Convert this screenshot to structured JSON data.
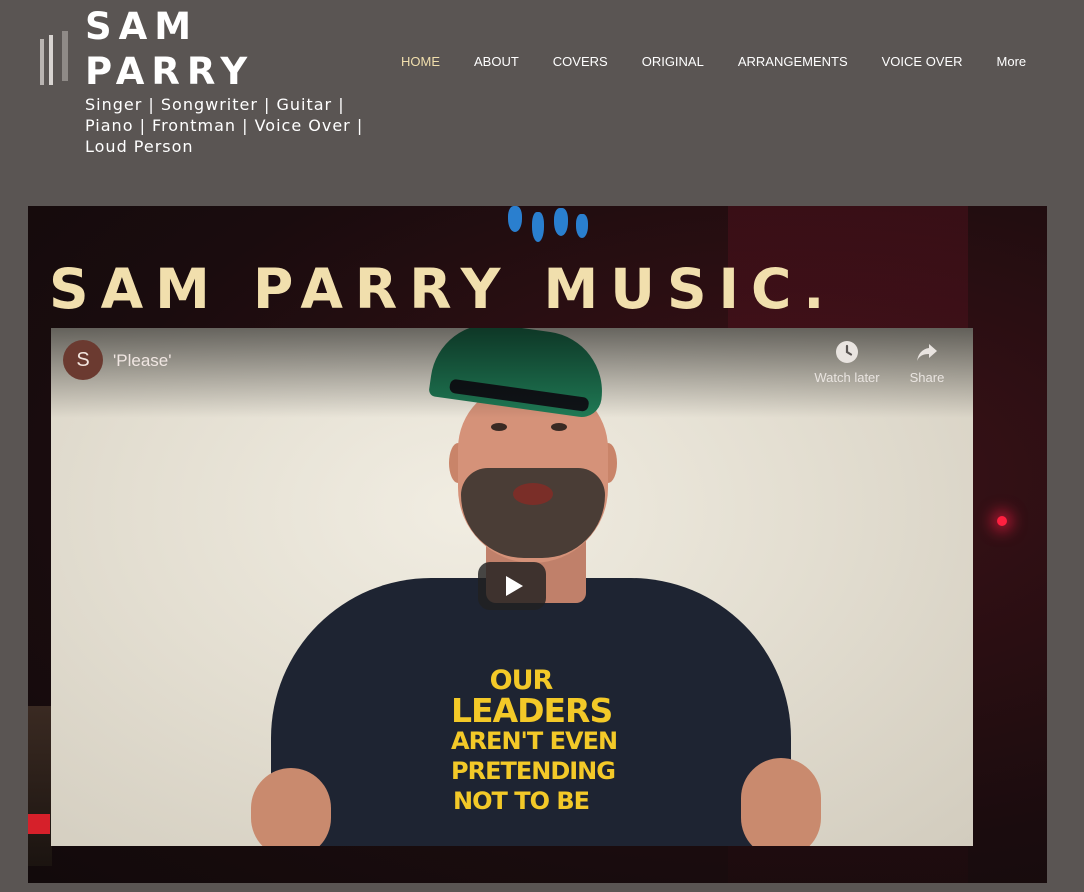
{
  "header": {
    "site_name_line1": "SAM",
    "site_name_line2": "PARRY",
    "tagline": "Singer | Songwriter | Guitar | Piano | Frontman | Voice Over | Loud Person"
  },
  "nav": {
    "items": [
      {
        "label": "HOME"
      },
      {
        "label": "ABOUT"
      },
      {
        "label": "COVERS"
      },
      {
        "label": "ORIGINAL"
      },
      {
        "label": "ARRANGEMENTS"
      },
      {
        "label": "VOICE OVER"
      },
      {
        "label": "More"
      }
    ],
    "active_color": "#f1dfad"
  },
  "hero": {
    "title": "SAM PARRY MUSIC."
  },
  "video": {
    "channel_initial": "S",
    "title": "'Please'",
    "watch_later": "Watch later",
    "share": "Share",
    "shirt_text": [
      "OUR",
      "LEADERS",
      "AREN'T EVEN",
      "PRETENDING",
      "NOT TO BE"
    ]
  },
  "colors": {
    "header_bg": "#5a5553",
    "accent": "#f1dfad",
    "shirt_text": "#f3c928"
  }
}
